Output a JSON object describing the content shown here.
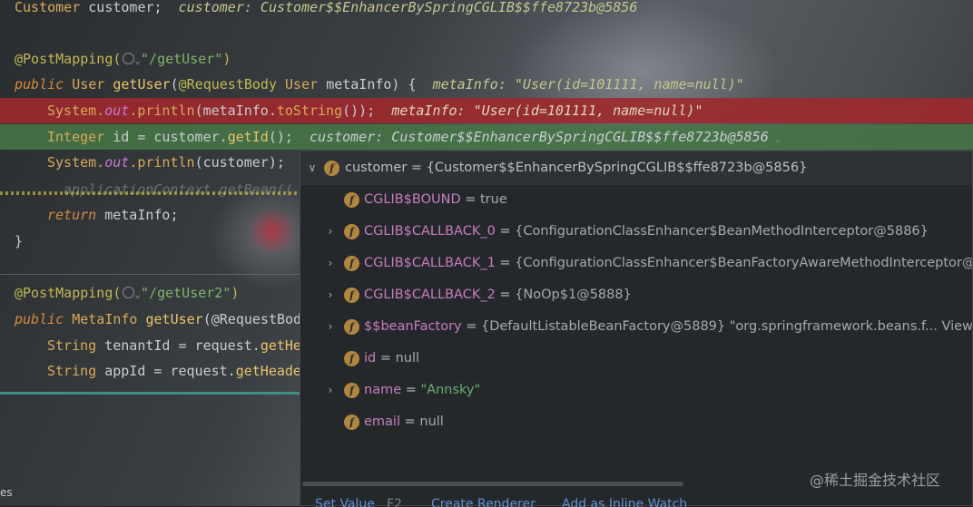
{
  "code": {
    "l0": {
      "type": "Customer",
      "var": "customer;",
      "hint": "customer: Customer$$EnhancerBySpringCGLIB$$ffe8723b@5856"
    },
    "l2": {
      "annotation": "@PostMapping(",
      "path": "\"/getUser\"",
      "close": ")"
    },
    "l3": {
      "kw": "public",
      "type": "User",
      "method": "getUser",
      "open": "(",
      "param_ann": "@RequestBody",
      "param_type": "User",
      "param": "metaInfo) {",
      "hint": "metaInfo: \"User(id=101111, name=null)\""
    },
    "l4": {
      "sys": "System.",
      "out": "out",
      "println": ".println",
      "args": "(metaInfo.",
      "tostr": "toString",
      "rest": "());",
      "hint": "metaInfo: \"User(id=101111, name=null)\""
    },
    "l5": {
      "type": "Integer",
      "mid": "id = customer.",
      "getter": "getId",
      "end": "();",
      "hint": "customer: Customer$$EnhancerBySpringCGLIB$$ffe8723b@5856"
    },
    "l6": {
      "sys": "System.",
      "out": "out",
      "println": ".println",
      "args": "(customer);"
    },
    "l7": {
      "text": "applicationContext.getBean(("
    },
    "l8": {
      "kw": "return",
      "rest": "metaInfo;"
    },
    "l9": {
      "text": "}"
    },
    "l11": {
      "annotation": "@PostMapping(",
      "path": "\"/getUser2\"",
      "close": ")"
    },
    "l12": {
      "kw": "public",
      "type": "MetaInfo",
      "method": "getUser",
      "rest": "(@RequestBod"
    },
    "l13": {
      "type": "String",
      "mid": "tenantId = request.",
      "call": "getHe"
    },
    "l14": {
      "type": "String",
      "mid": "appId = request.",
      "call": "getHeade"
    }
  },
  "popup": {
    "root": {
      "name": "customer",
      "value": "{Customer$$EnhancerBySpringCGLIB$$ffe8723b@5856}"
    },
    "fields": [
      {
        "name": "CGLIB$BOUND",
        "value": "true",
        "expandable": false,
        "kind": "plain"
      },
      {
        "name": "CGLIB$CALLBACK_0",
        "value": "{ConfigurationClassEnhancer$BeanMethodInterceptor@5886}",
        "expandable": true,
        "kind": "plain"
      },
      {
        "name": "CGLIB$CALLBACK_1",
        "value": "{ConfigurationClassEnhancer$BeanFactoryAwareMethodInterceptor@",
        "expandable": true,
        "kind": "plain"
      },
      {
        "name": "CGLIB$CALLBACK_2",
        "value": "{NoOp$1@5888}",
        "expandable": true,
        "kind": "plain"
      },
      {
        "name": "$$beanFactory",
        "value": "{DefaultListableBeanFactory@5889} \"org.springframework.beans.f...",
        "link": "View",
        "expandable": true,
        "kind": "purple"
      },
      {
        "name": "id",
        "value": "null",
        "expandable": false,
        "kind": "plain"
      },
      {
        "name": "name",
        "value": "\"Annsky\"",
        "expandable": true,
        "kind": "plain",
        "string": true
      },
      {
        "name": "email",
        "value": "null",
        "expandable": false,
        "kind": "plain"
      }
    ],
    "bottom": {
      "set_value": "Set Value",
      "set_value_key": "F2",
      "create_renderer": "Create Renderer",
      "add_watch": "Add as Inline Watch"
    }
  },
  "field_badge": "f",
  "watermark": "@稀土掘金技术社区",
  "edge_text": "es"
}
